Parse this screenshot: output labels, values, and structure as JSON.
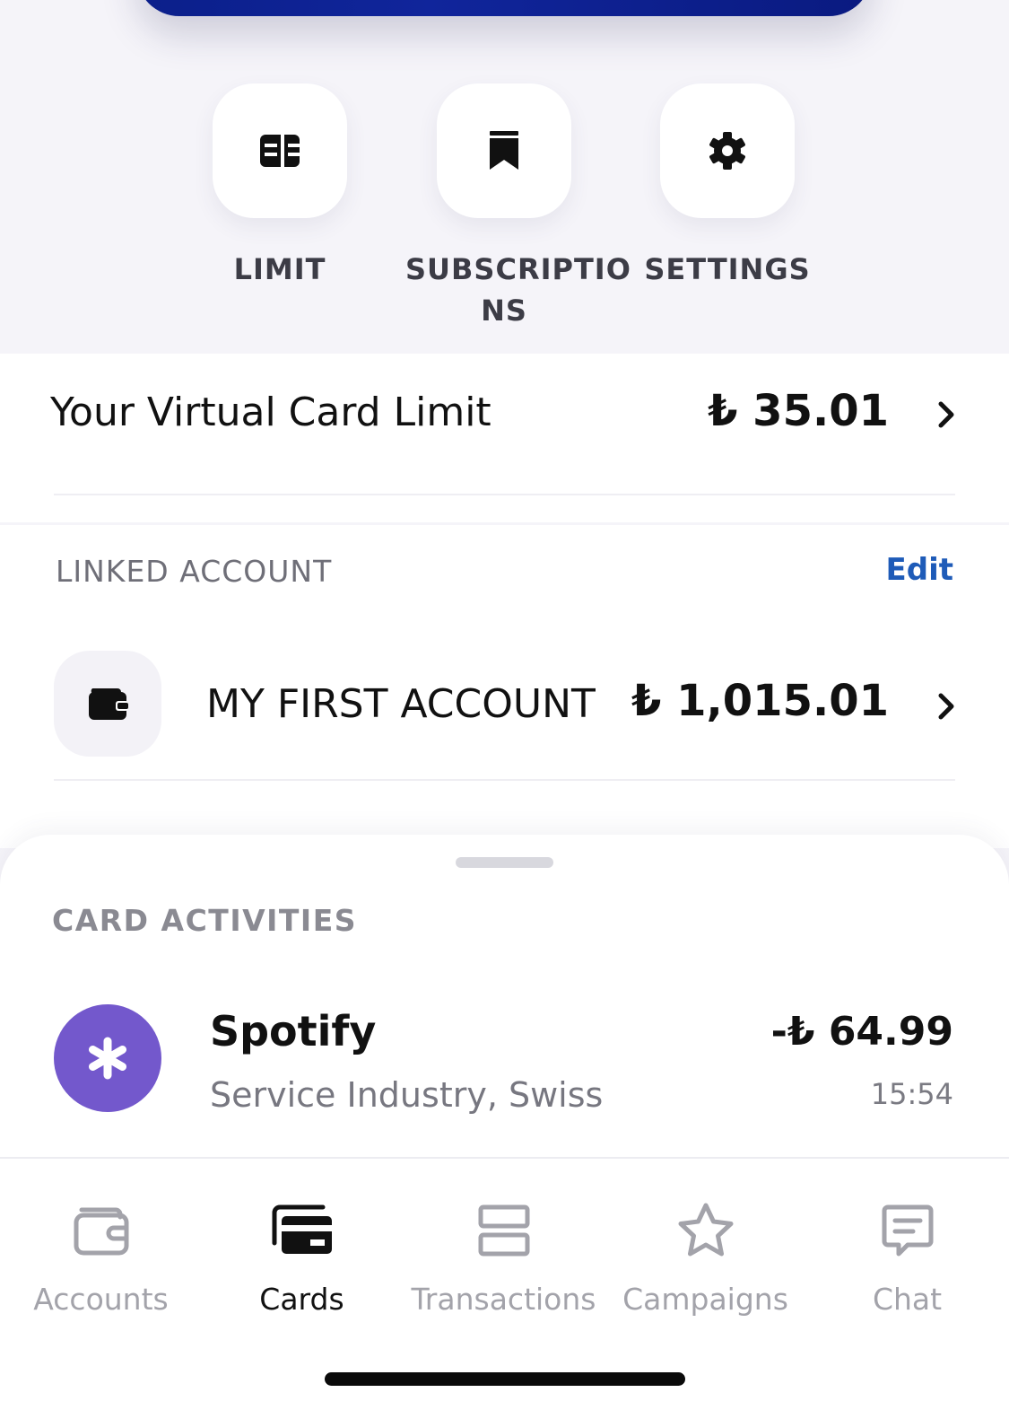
{
  "quick_actions": [
    {
      "label": "LIMIT",
      "icon": "card-chip-icon"
    },
    {
      "label": "SUBSCRIPTIO\nNS",
      "icon": "bookmark-icon"
    },
    {
      "label": "SETTINGS",
      "icon": "gear-icon"
    }
  ],
  "limit": {
    "title": "Your Virtual Card Limit",
    "amount": "₺ 35.01"
  },
  "linked_account": {
    "header": "LINKED ACCOUNT",
    "edit_label": "Edit",
    "account_name": "MY FIRST ACCOUNT",
    "balance": "₺ 1,015.01",
    "icon": "wallet-icon"
  },
  "activities": {
    "title": "CARD ACTIVITIES",
    "items": [
      {
        "name": "Spotify",
        "subtitle": "Service Industry, Swiss",
        "amount": "-₺ 64.99",
        "time": "15:54",
        "avatar_color": "#7358cc",
        "icon": "asterisk-icon"
      }
    ]
  },
  "tabbar": {
    "active": "Cards",
    "items": [
      {
        "label": "Accounts",
        "icon": "wallet-outline-icon"
      },
      {
        "label": "Cards",
        "icon": "cards-icon"
      },
      {
        "label": "Transactions",
        "icon": "list-rows-icon"
      },
      {
        "label": "Campaigns",
        "icon": "star-icon"
      },
      {
        "label": "Chat",
        "icon": "chat-icon"
      }
    ]
  },
  "colors": {
    "accent": "#1e5bb8",
    "card_blue": "#10259b",
    "avatar_purple": "#7358cc"
  }
}
